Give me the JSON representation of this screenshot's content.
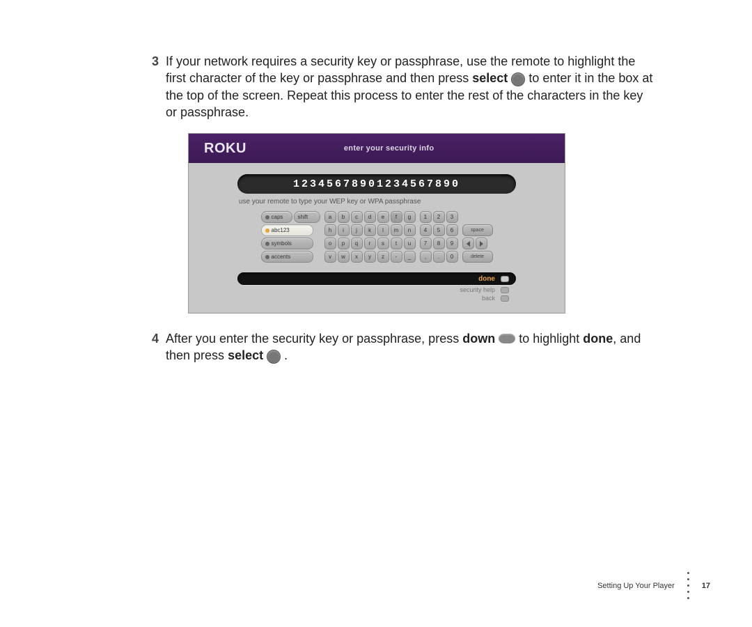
{
  "steps": {
    "s3": {
      "num": "3",
      "t1": "If your network requires a security key or passphrase, use the remote to highlight the first character of the key or passphrase and then press ",
      "b1": "select",
      "t2": " to enter it in the box at the top of the screen. Repeat this process to enter the rest of the characters in the key or passphrase."
    },
    "s4": {
      "num": "4",
      "t1": "After you enter the security key or passphrase, press ",
      "b1": "down",
      "t2": " to highlight ",
      "b2": "done",
      "t3": ", and then press ",
      "b3": "select",
      "t4": " ."
    }
  },
  "shot": {
    "logo": "ROKU",
    "title": "enter your security info",
    "input": "12345678901234567890",
    "hint": "use your remote to type your WEP key or WPA passphrase",
    "modes": {
      "caps": "caps",
      "shift": "shift",
      "abc": "abc123",
      "sym": "symbols",
      "acc": "accents"
    },
    "rows": {
      "r1": [
        "a",
        "b",
        "c",
        "d",
        "e",
        "f",
        "g"
      ],
      "r2": [
        "h",
        "i",
        "j",
        "k",
        "l",
        "m",
        "n"
      ],
      "r3": [
        "o",
        "p",
        "q",
        "r",
        "s",
        "t",
        "u"
      ],
      "r4": [
        "v",
        "w",
        "x",
        "y",
        "z",
        "-",
        "_"
      ]
    },
    "nums": {
      "n1": [
        "1",
        "2",
        "3"
      ],
      "n2": [
        "4",
        "5",
        "6"
      ],
      "n3": [
        "7",
        "8",
        "9"
      ],
      "n4": [
        ",",
        ".",
        "0"
      ]
    },
    "side": {
      "space": "space",
      "delete": "delete"
    },
    "menu": {
      "done": "done",
      "help": "security help",
      "back": "back"
    }
  },
  "footer": {
    "section": "Setting Up Your Player",
    "page": "17"
  }
}
